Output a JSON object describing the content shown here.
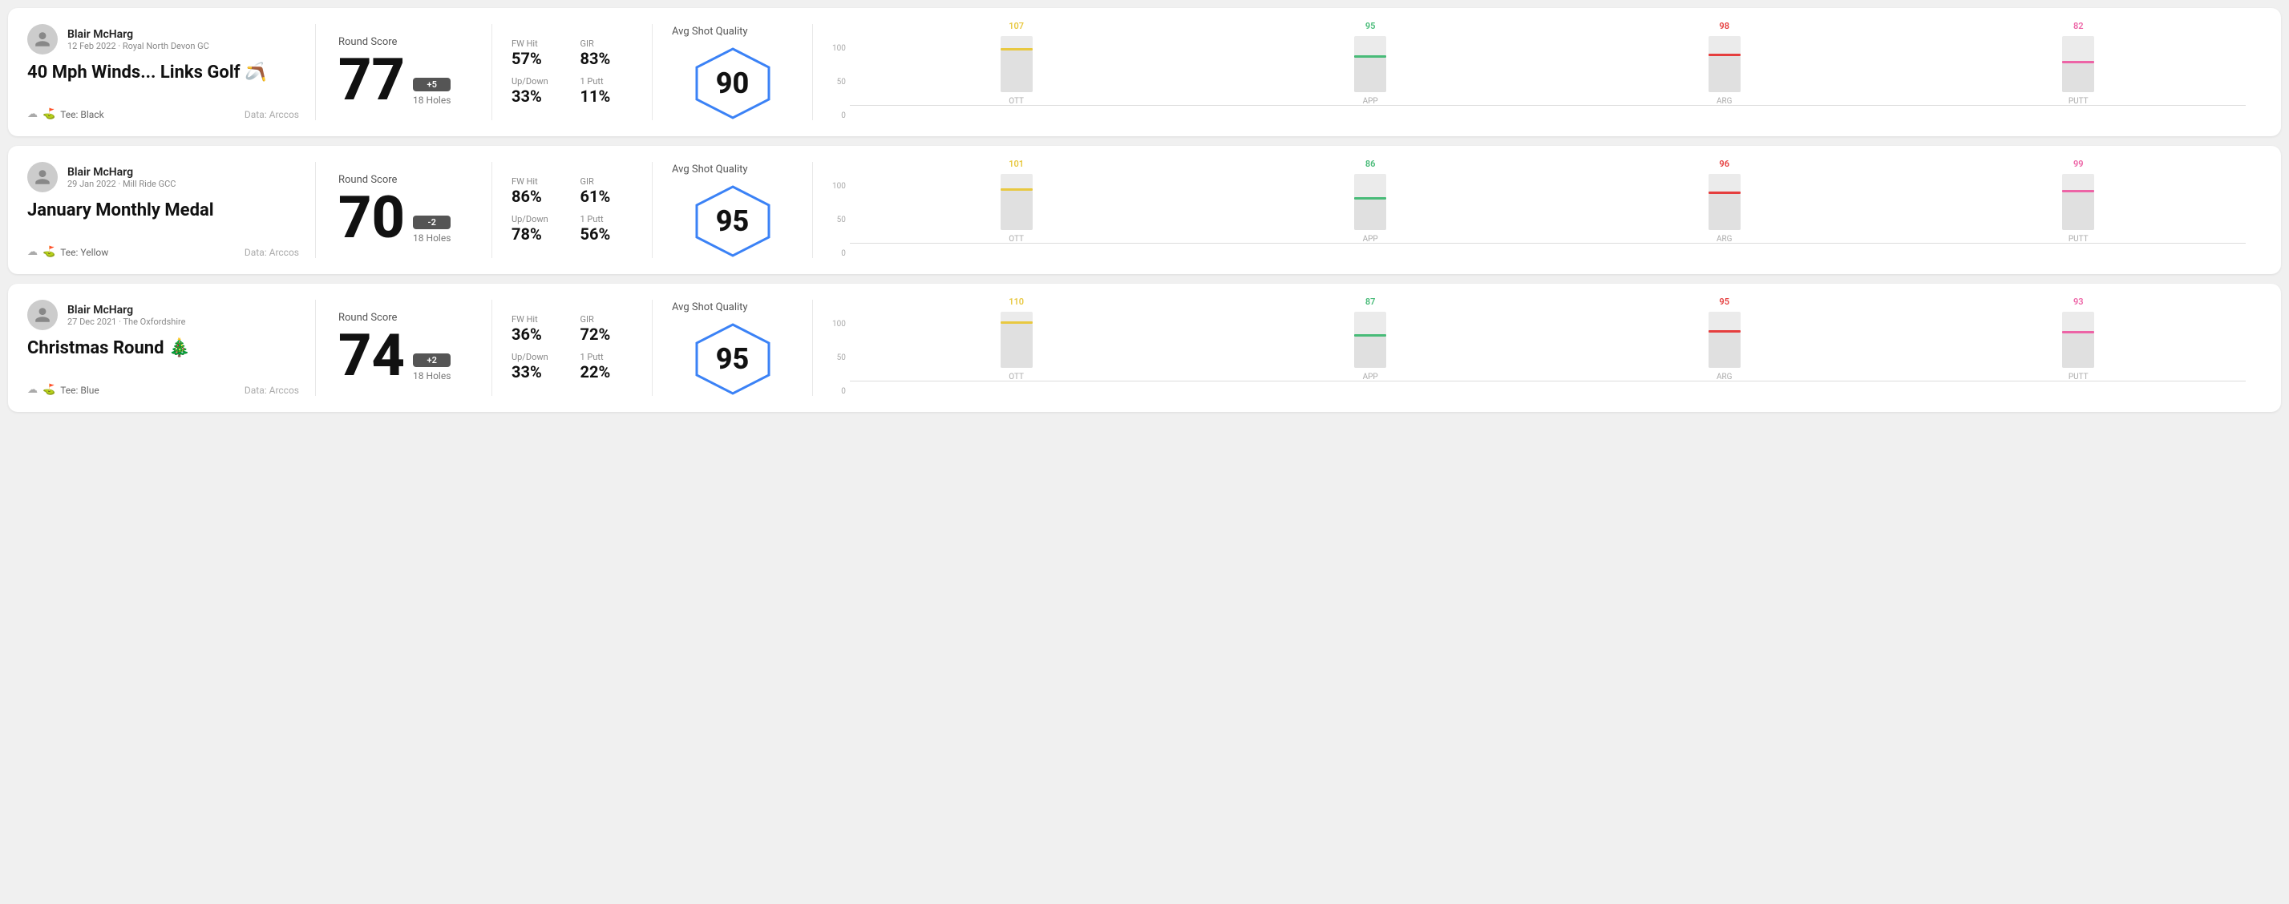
{
  "rounds": [
    {
      "id": "round-1",
      "player_name": "Blair McHarg",
      "date_course": "12 Feb 2022 · Royal North Devon GC",
      "title": "40 Mph Winds... Links Golf 🪃",
      "tee": "Black",
      "data_source": "Data: Arccos",
      "score": 77,
      "score_diff": "+5",
      "score_diff_type": "positive",
      "holes": "18 Holes",
      "fw_hit": "57%",
      "gir": "83%",
      "up_down": "33%",
      "one_putt": "11%",
      "avg_shot_quality": 90,
      "chart": {
        "bars": [
          {
            "label": "OTT",
            "value": 107,
            "color": "#e8c840",
            "fill_pct": 75
          },
          {
            "label": "APP",
            "value": 95,
            "color": "#48bb78",
            "fill_pct": 62
          },
          {
            "label": "ARG",
            "value": 98,
            "color": "#e53e3e",
            "fill_pct": 65
          },
          {
            "label": "PUTT",
            "value": 82,
            "color": "#ed64a6",
            "fill_pct": 52
          }
        ],
        "y_labels": [
          "100",
          "50",
          "0"
        ]
      }
    },
    {
      "id": "round-2",
      "player_name": "Blair McHarg",
      "date_course": "29 Jan 2022 · Mill Ride GCC",
      "title": "January Monthly Medal",
      "tee": "Yellow",
      "data_source": "Data: Arccos",
      "score": 70,
      "score_diff": "-2",
      "score_diff_type": "negative",
      "holes": "18 Holes",
      "fw_hit": "86%",
      "gir": "61%",
      "up_down": "78%",
      "one_putt": "56%",
      "avg_shot_quality": 95,
      "chart": {
        "bars": [
          {
            "label": "OTT",
            "value": 101,
            "color": "#e8c840",
            "fill_pct": 70
          },
          {
            "label": "APP",
            "value": 86,
            "color": "#48bb78",
            "fill_pct": 55
          },
          {
            "label": "ARG",
            "value": 96,
            "color": "#e53e3e",
            "fill_pct": 64
          },
          {
            "label": "PUTT",
            "value": 99,
            "color": "#ed64a6",
            "fill_pct": 67
          }
        ],
        "y_labels": [
          "100",
          "50",
          "0"
        ]
      }
    },
    {
      "id": "round-3",
      "player_name": "Blair McHarg",
      "date_course": "27 Dec 2021 · The Oxfordshire",
      "title": "Christmas Round 🎄",
      "tee": "Blue",
      "data_source": "Data: Arccos",
      "score": 74,
      "score_diff": "+2",
      "score_diff_type": "positive",
      "holes": "18 Holes",
      "fw_hit": "36%",
      "gir": "72%",
      "up_down": "33%",
      "one_putt": "22%",
      "avg_shot_quality": 95,
      "chart": {
        "bars": [
          {
            "label": "OTT",
            "value": 110,
            "color": "#e8c840",
            "fill_pct": 78
          },
          {
            "label": "APP",
            "value": 87,
            "color": "#48bb78",
            "fill_pct": 56
          },
          {
            "label": "ARG",
            "value": 95,
            "color": "#e53e3e",
            "fill_pct": 63
          },
          {
            "label": "PUTT",
            "value": 93,
            "color": "#ed64a6",
            "fill_pct": 62
          }
        ],
        "y_labels": [
          "100",
          "50",
          "0"
        ]
      }
    }
  ],
  "labels": {
    "round_score": "Round Score",
    "fw_hit": "FW Hit",
    "gir": "GIR",
    "up_down": "Up/Down",
    "one_putt": "1 Putt",
    "avg_shot_quality": "Avg Shot Quality",
    "tee_prefix": "Tee:",
    "data_label": "Data: Arccos"
  }
}
